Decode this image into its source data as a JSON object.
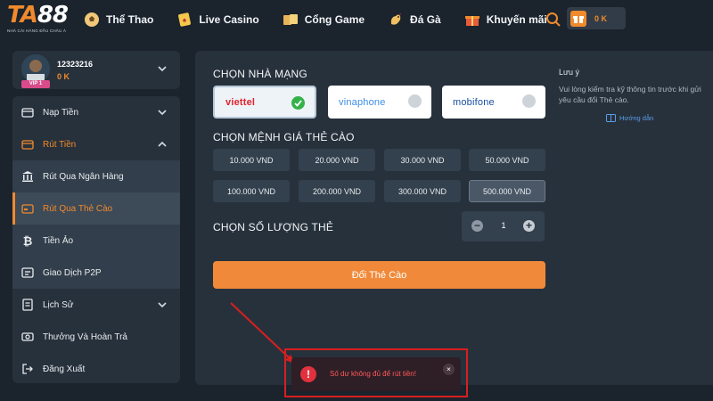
{
  "brand": {
    "name_orange": "TA",
    "name_white": "88",
    "tagline": "NHÀ CÁI HÀNG ĐẦU CHÂU Á"
  },
  "nav": [
    {
      "label": "Thể Thao",
      "icon": "soccer-ball-icon"
    },
    {
      "label": "Live Casino",
      "icon": "playing-card-icon"
    },
    {
      "label": "Cổng Game",
      "icon": "game-cards-icon"
    },
    {
      "label": "Đá Gà",
      "icon": "rooster-icon"
    },
    {
      "label": "Khuyến mãi",
      "icon": "gift-box-icon"
    }
  ],
  "header": {
    "balance": "0 K",
    "search_icon": "search-icon",
    "wallet_icon": "gift-icon"
  },
  "user": {
    "id": "12323216",
    "balance": "0 K",
    "vip": "VIP 1"
  },
  "sidebar": {
    "items": [
      {
        "label": "Nạp Tiền",
        "icon": "deposit-icon"
      },
      {
        "label": "Rút Tiền",
        "icon": "withdraw-icon"
      },
      {
        "label": "Rút Qua Ngân Hàng",
        "icon": "bank-icon"
      },
      {
        "label": "Rút Qua Thẻ Cào",
        "icon": "card-icon"
      },
      {
        "label": "Tiền Ảo",
        "icon": "bitcoin-icon"
      },
      {
        "label": "Giao Dịch P2P",
        "icon": "p2p-icon"
      },
      {
        "label": "Lịch Sử",
        "icon": "history-icon"
      },
      {
        "label": "Thưởng Và Hoàn Trả",
        "icon": "reward-icon"
      },
      {
        "label": "Đăng Xuất",
        "icon": "logout-icon"
      }
    ]
  },
  "form": {
    "network_title": "CHỌN NHÀ MẠNG",
    "networks": [
      {
        "label": "viettel",
        "selected": true,
        "color": "#e0232d"
      },
      {
        "label": "vinaphone",
        "selected": false,
        "color": "#3a8ee6"
      },
      {
        "label": "mobifone",
        "selected": false,
        "color": "#1a4fa3"
      }
    ],
    "denom_title": "CHỌN MỆNH GIÁ THẺ CÀO",
    "denominations": [
      "10.000 VND",
      "20.000 VND",
      "30.000 VND",
      "50.000 VND",
      "100.000 VND",
      "200.000 VND",
      "300.000 VND",
      "500.000 VND"
    ],
    "selected_denomination": "500.000 VND",
    "qty_title": "CHỌN SỐ LƯỢNG THẺ",
    "quantity": "1",
    "submit_label": "Đổi Thẻ Cào"
  },
  "note": {
    "title": "Lưu ý",
    "body": "Vui lòng kiểm tra kỹ thông tin trước khi gửi yêu cầu đổi Thẻ cào.",
    "guide_label": "Hướng dẫn"
  },
  "toast": {
    "message": "Số dư không đủ để rút tiền!",
    "icon": "exclamation-icon"
  },
  "colors": {
    "accent": "#f08a2c",
    "panel": "#27313c",
    "background": "#1b232d",
    "error": "#e0323e"
  }
}
